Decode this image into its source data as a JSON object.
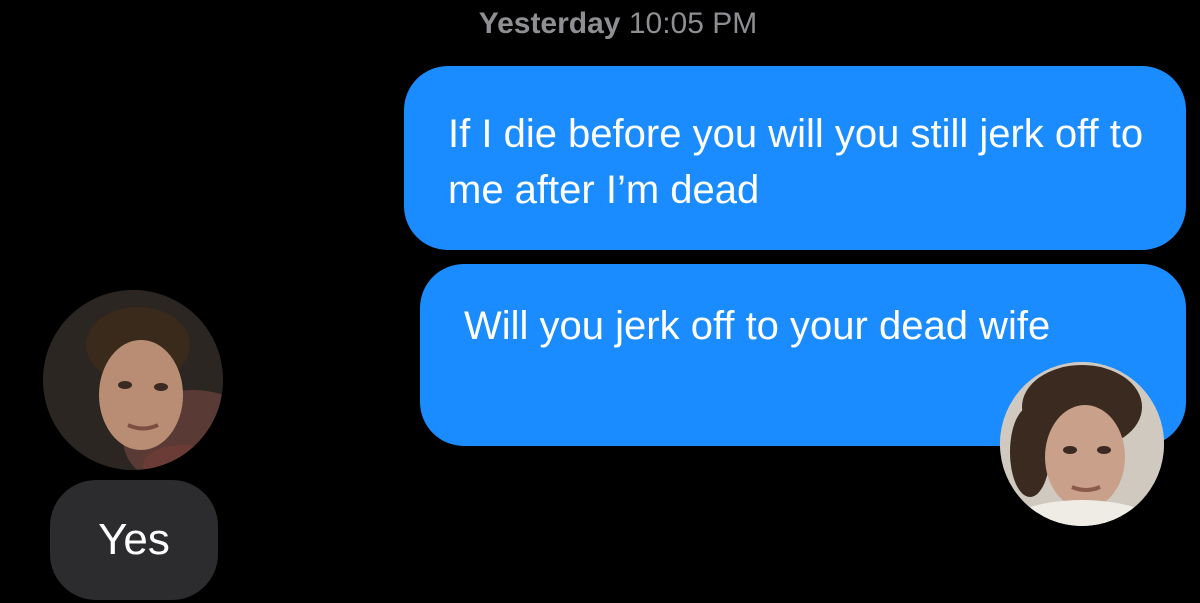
{
  "header": {
    "timestamp_day": "Yesterday",
    "timestamp_time": "10:05 PM"
  },
  "messages": [
    {
      "sender": "me",
      "text": "If I die before you will you still jerk off to me after I’m dead"
    },
    {
      "sender": "me",
      "text": "Will you jerk off to your dead wife"
    },
    {
      "sender": "contact",
      "text": "Yes"
    }
  ],
  "colors": {
    "background": "#000000",
    "outgoing_bubble": "#1a8cff",
    "incoming_bubble": "#2c2c2e",
    "timestamp": "#8e8e93"
  }
}
